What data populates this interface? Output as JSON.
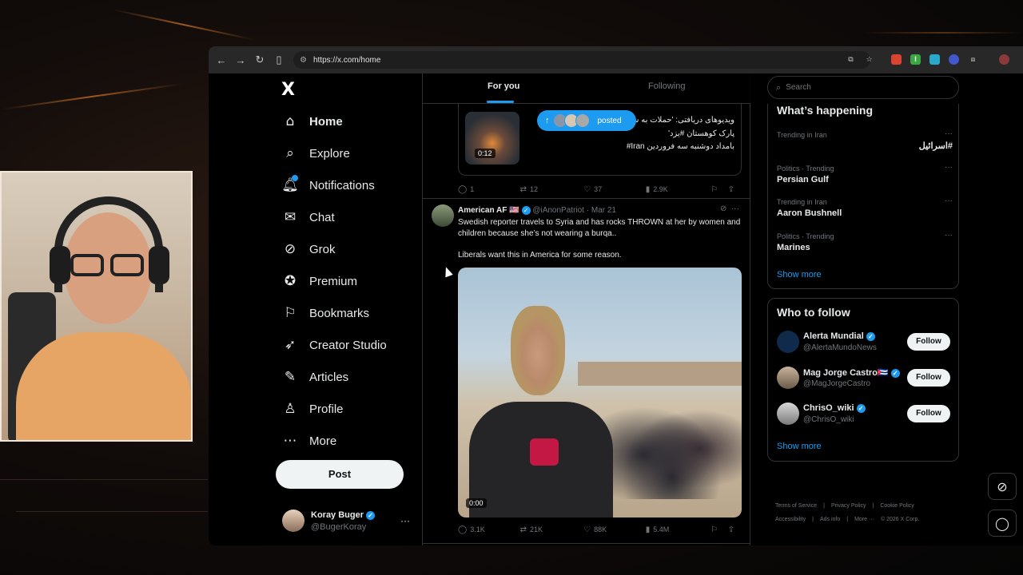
{
  "browser": {
    "url": "https://x.com/home",
    "nav_icons": [
      "back-icon",
      "forward-icon",
      "reload-icon",
      "sidebar-icon"
    ],
    "extension_icons": [
      "screen-icon",
      "star-icon",
      "ext-red-icon",
      "ext-green-icon",
      "ext-teal-icon",
      "ext-blue-icon",
      "puzzle-icon",
      "profile-icon"
    ]
  },
  "sidebar": {
    "logo": "X",
    "items": [
      {
        "label": "Home",
        "icon": "home-icon",
        "glyph": "⌂"
      },
      {
        "label": "Explore",
        "icon": "search-icon",
        "glyph": "⌕"
      },
      {
        "label": "Notifications",
        "icon": "bell-icon",
        "glyph": "🔔︎"
      },
      {
        "label": "Chat",
        "icon": "mail-icon",
        "glyph": "✉"
      },
      {
        "label": "Grok",
        "icon": "grok-icon",
        "glyph": "⊘"
      },
      {
        "label": "Premium",
        "icon": "premium-icon",
        "glyph": "✪"
      },
      {
        "label": "Bookmarks",
        "icon": "bookmark-icon",
        "glyph": "⚐"
      },
      {
        "label": "Creator Studio",
        "icon": "rocket-icon",
        "glyph": "➶"
      },
      {
        "label": "Articles",
        "icon": "articles-icon",
        "glyph": "✎"
      },
      {
        "label": "Profile",
        "icon": "person-icon",
        "glyph": "♙"
      },
      {
        "label": "More",
        "icon": "more-circle-icon",
        "glyph": "⋯"
      }
    ],
    "post_label": "Post",
    "account": {
      "name": "Koray Buger",
      "handle": "@BugerKoray",
      "more": "···"
    }
  },
  "timeline": {
    "tabs": [
      {
        "label": "For you"
      },
      {
        "label": "Following"
      }
    ],
    "post1": {
      "lines": [
        "ویدیوهای دریافتی: 'حملات به ش",
        "پارک کوهستان #یزد'",
        "بامداد دوشنبه سه فروردین Iran#"
      ],
      "duration": "0:12",
      "actions": {
        "replies": "1",
        "reposts": "12",
        "likes": "37",
        "views": "2.9K"
      }
    },
    "posted_pill": {
      "arrow": "↑",
      "text": "posted"
    },
    "post2": {
      "name": "American AF 🇺🇸",
      "handle": "@iAnonPatriot",
      "date": "· Mar 21",
      "text": "Swedish reporter travels to Syria and has rocks THROWN at her by women and children because she’s not wearing a burqa..",
      "text2": "Liberals want this in America for some reason.",
      "duration": "0:00",
      "actions": {
        "replies": "3.1K",
        "reposts": "21K",
        "likes": "88K",
        "views": "5.4M"
      }
    }
  },
  "right": {
    "search_placeholder": "Search",
    "happening": {
      "title": "What’s happening",
      "trends": [
        {
          "context": "Trending in Iran",
          "name": "#اسرائیل"
        },
        {
          "context": "Politics · Trending",
          "name": "Persian Gulf"
        },
        {
          "context": "Trending in Iran",
          "name": "Aaron Bushnell"
        },
        {
          "context": "Politics · Trending",
          "name": "Marines"
        }
      ],
      "show_more": "Show more"
    },
    "who_to_follow": {
      "title": "Who to follow",
      "accounts": [
        {
          "name": "Alerta Mundial",
          "handle": "@AlertaMundoNews",
          "follow": "Follow"
        },
        {
          "name": "Mag Jorge Castro🇨🇺",
          "handle": "@MagJorgeCastro",
          "follow": "Follow"
        },
        {
          "name": "ChrisO_wiki",
          "handle": "@ChrisO_wiki",
          "follow": "Follow"
        }
      ],
      "show_more": "Show more"
    },
    "footer": [
      "Terms of Service",
      "|",
      "Privacy Policy",
      "|",
      "Cookie Policy",
      "|",
      "Accessibility",
      "|",
      "Ads info",
      "|",
      "More ···",
      "© 2026 X Corp."
    ]
  },
  "floating": [
    "grok-float-icon",
    "chat-float-icon"
  ]
}
